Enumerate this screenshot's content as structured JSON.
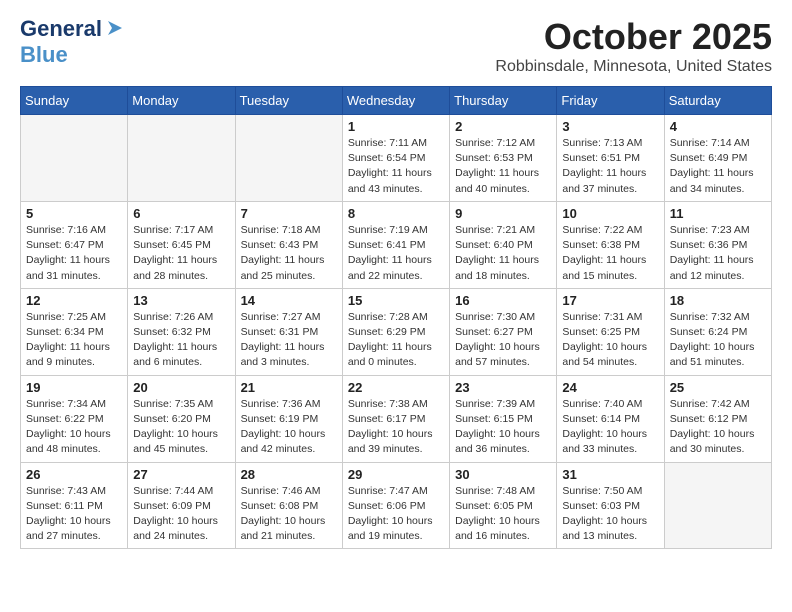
{
  "header": {
    "logo_general": "General",
    "logo_blue": "Blue",
    "month_title": "October 2025",
    "location": "Robbinsdale, Minnesota, United States"
  },
  "calendar": {
    "days_of_week": [
      "Sunday",
      "Monday",
      "Tuesday",
      "Wednesday",
      "Thursday",
      "Friday",
      "Saturday"
    ],
    "weeks": [
      [
        {
          "day": "",
          "info": ""
        },
        {
          "day": "",
          "info": ""
        },
        {
          "day": "",
          "info": ""
        },
        {
          "day": "1",
          "info": "Sunrise: 7:11 AM\nSunset: 6:54 PM\nDaylight: 11 hours\nand 43 minutes."
        },
        {
          "day": "2",
          "info": "Sunrise: 7:12 AM\nSunset: 6:53 PM\nDaylight: 11 hours\nand 40 minutes."
        },
        {
          "day": "3",
          "info": "Sunrise: 7:13 AM\nSunset: 6:51 PM\nDaylight: 11 hours\nand 37 minutes."
        },
        {
          "day": "4",
          "info": "Sunrise: 7:14 AM\nSunset: 6:49 PM\nDaylight: 11 hours\nand 34 minutes."
        }
      ],
      [
        {
          "day": "5",
          "info": "Sunrise: 7:16 AM\nSunset: 6:47 PM\nDaylight: 11 hours\nand 31 minutes."
        },
        {
          "day": "6",
          "info": "Sunrise: 7:17 AM\nSunset: 6:45 PM\nDaylight: 11 hours\nand 28 minutes."
        },
        {
          "day": "7",
          "info": "Sunrise: 7:18 AM\nSunset: 6:43 PM\nDaylight: 11 hours\nand 25 minutes."
        },
        {
          "day": "8",
          "info": "Sunrise: 7:19 AM\nSunset: 6:41 PM\nDaylight: 11 hours\nand 22 minutes."
        },
        {
          "day": "9",
          "info": "Sunrise: 7:21 AM\nSunset: 6:40 PM\nDaylight: 11 hours\nand 18 minutes."
        },
        {
          "day": "10",
          "info": "Sunrise: 7:22 AM\nSunset: 6:38 PM\nDaylight: 11 hours\nand 15 minutes."
        },
        {
          "day": "11",
          "info": "Sunrise: 7:23 AM\nSunset: 6:36 PM\nDaylight: 11 hours\nand 12 minutes."
        }
      ],
      [
        {
          "day": "12",
          "info": "Sunrise: 7:25 AM\nSunset: 6:34 PM\nDaylight: 11 hours\nand 9 minutes."
        },
        {
          "day": "13",
          "info": "Sunrise: 7:26 AM\nSunset: 6:32 PM\nDaylight: 11 hours\nand 6 minutes."
        },
        {
          "day": "14",
          "info": "Sunrise: 7:27 AM\nSunset: 6:31 PM\nDaylight: 11 hours\nand 3 minutes."
        },
        {
          "day": "15",
          "info": "Sunrise: 7:28 AM\nSunset: 6:29 PM\nDaylight: 11 hours\nand 0 minutes."
        },
        {
          "day": "16",
          "info": "Sunrise: 7:30 AM\nSunset: 6:27 PM\nDaylight: 10 hours\nand 57 minutes."
        },
        {
          "day": "17",
          "info": "Sunrise: 7:31 AM\nSunset: 6:25 PM\nDaylight: 10 hours\nand 54 minutes."
        },
        {
          "day": "18",
          "info": "Sunrise: 7:32 AM\nSunset: 6:24 PM\nDaylight: 10 hours\nand 51 minutes."
        }
      ],
      [
        {
          "day": "19",
          "info": "Sunrise: 7:34 AM\nSunset: 6:22 PM\nDaylight: 10 hours\nand 48 minutes."
        },
        {
          "day": "20",
          "info": "Sunrise: 7:35 AM\nSunset: 6:20 PM\nDaylight: 10 hours\nand 45 minutes."
        },
        {
          "day": "21",
          "info": "Sunrise: 7:36 AM\nSunset: 6:19 PM\nDaylight: 10 hours\nand 42 minutes."
        },
        {
          "day": "22",
          "info": "Sunrise: 7:38 AM\nSunset: 6:17 PM\nDaylight: 10 hours\nand 39 minutes."
        },
        {
          "day": "23",
          "info": "Sunrise: 7:39 AM\nSunset: 6:15 PM\nDaylight: 10 hours\nand 36 minutes."
        },
        {
          "day": "24",
          "info": "Sunrise: 7:40 AM\nSunset: 6:14 PM\nDaylight: 10 hours\nand 33 minutes."
        },
        {
          "day": "25",
          "info": "Sunrise: 7:42 AM\nSunset: 6:12 PM\nDaylight: 10 hours\nand 30 minutes."
        }
      ],
      [
        {
          "day": "26",
          "info": "Sunrise: 7:43 AM\nSunset: 6:11 PM\nDaylight: 10 hours\nand 27 minutes."
        },
        {
          "day": "27",
          "info": "Sunrise: 7:44 AM\nSunset: 6:09 PM\nDaylight: 10 hours\nand 24 minutes."
        },
        {
          "day": "28",
          "info": "Sunrise: 7:46 AM\nSunset: 6:08 PM\nDaylight: 10 hours\nand 21 minutes."
        },
        {
          "day": "29",
          "info": "Sunrise: 7:47 AM\nSunset: 6:06 PM\nDaylight: 10 hours\nand 19 minutes."
        },
        {
          "day": "30",
          "info": "Sunrise: 7:48 AM\nSunset: 6:05 PM\nDaylight: 10 hours\nand 16 minutes."
        },
        {
          "day": "31",
          "info": "Sunrise: 7:50 AM\nSunset: 6:03 PM\nDaylight: 10 hours\nand 13 minutes."
        },
        {
          "day": "",
          "info": ""
        }
      ]
    ]
  }
}
